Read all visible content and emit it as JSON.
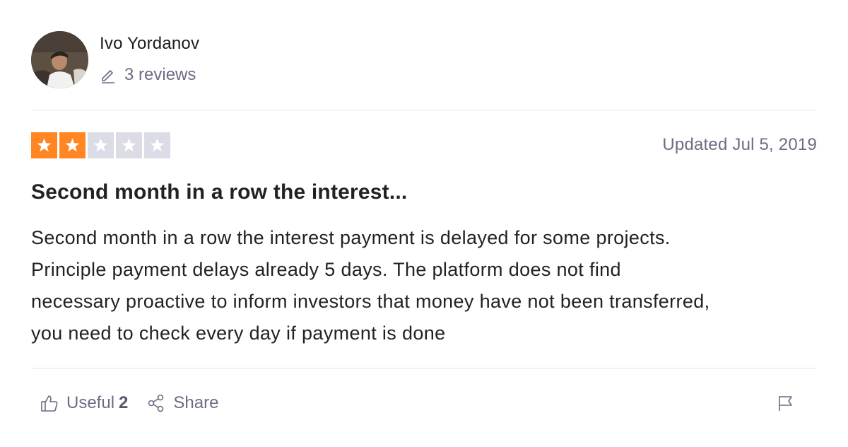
{
  "consumer": {
    "name": "Ivo Yordanov",
    "reviews_label": "3 reviews"
  },
  "review": {
    "rating": 2,
    "max_rating": 5,
    "date": "Updated Jul 5, 2019",
    "title": "Second month in a row the interest...",
    "body": "Second month in a row the interest payment is delayed for some projects.\nPrinciple payment delays already 5 days. The platform does not find\nnecessary proactive to inform investors that money have not been transferred,\nyou need to check every day if payment is done"
  },
  "actions": {
    "useful_label": "Useful",
    "useful_count": "2",
    "share_label": "Share"
  },
  "colors": {
    "star_filled": "#ff8622",
    "star_empty": "#dcdce6",
    "muted_text": "#6c6c85"
  },
  "icons": {
    "reviews": "pencil-icon",
    "useful": "thumbs-up-icon",
    "share": "share-icon",
    "report": "flag-icon"
  }
}
